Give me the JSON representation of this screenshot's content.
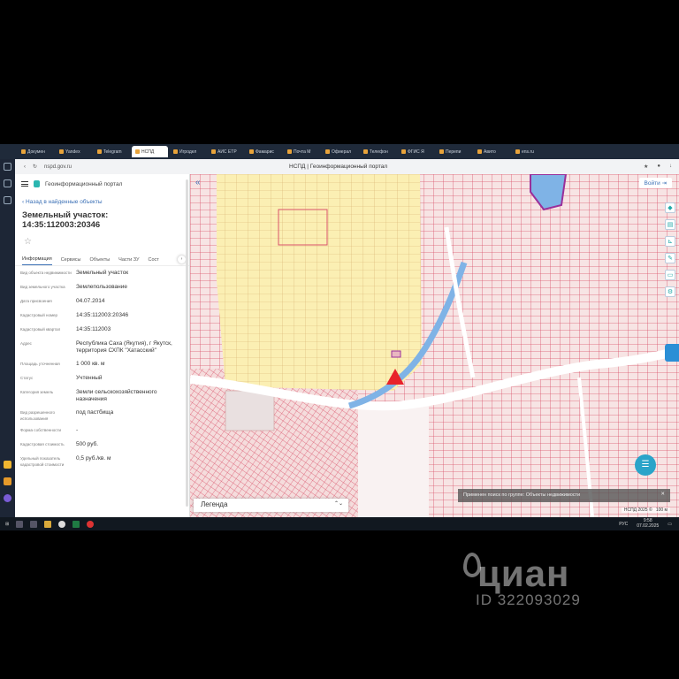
{
  "browser": {
    "tabs": [
      "Докумен",
      "Yandex",
      "Telegram",
      "НСПД",
      "Игродел",
      "АИС ЕТР",
      "Фамарис",
      "Почта М",
      "Офиерал",
      "Телефон",
      "ФГИС Я",
      "Перепи",
      "Авито",
      "ens.ru"
    ],
    "active_tab": "НСПД",
    "url": "nspd.gov.ru",
    "page_title": "НСПД | Геоинформационный портал"
  },
  "panel": {
    "portal_name": "Геоинформационный портал",
    "back_link": "Назад в найденные объекты",
    "title": "Земельный участок: 14:35:112003:20346",
    "tabs": [
      "Информация",
      "Сервисы",
      "Объекты",
      "Части ЗУ",
      "Сост"
    ],
    "active_tab": "Информация",
    "fields": [
      {
        "label": "Вид объекта недвижимости",
        "value": "Земельный участок"
      },
      {
        "label": "Вид земельного участка",
        "value": "Землепользование"
      },
      {
        "label": "Дата присвоения",
        "value": "04.07.2014"
      },
      {
        "label": "Кадастровый номер",
        "value": "14:35:112003:20346"
      },
      {
        "label": "Кадастровый квартал",
        "value": "14:35:112003"
      },
      {
        "label": "Адрес",
        "value": "Республика Саха (Якутия), г Якутск, территория СХПК \"Хатасский\""
      },
      {
        "label": "Площадь уточненная",
        "value": "1 000 кв. м"
      },
      {
        "label": "Статус",
        "value": "Учтенный"
      },
      {
        "label": "Категория земель",
        "value": "Земли сельскохозяйственного назначения"
      },
      {
        "label": "Вид разрешенного использования",
        "value": "под пастбища"
      },
      {
        "label": "Форма собственности",
        "value": "-"
      },
      {
        "label": "Кадастровая стоимость",
        "value": "500 руб."
      },
      {
        "label": "Удельный показатель кадастровой стоимости",
        "value": "0,5 руб./кв. м"
      }
    ]
  },
  "map": {
    "login_label": "Войти",
    "legend_label": "Легенда",
    "toast": "Применен поиск по группе: Объекты недвижимости",
    "attribution": "НСПД 2025 ©",
    "scale": "100 м",
    "colors": {
      "parcel_line": "#d9536b",
      "agri_fill": "#fbefb3",
      "water": "#7fb3e6",
      "marker": "#e8232a"
    }
  },
  "taskbar": {
    "time": "9:58",
    "date": "07.02.2025",
    "lang": "РУС"
  },
  "watermark": {
    "brand": "циан",
    "id": "ID 322093029"
  }
}
